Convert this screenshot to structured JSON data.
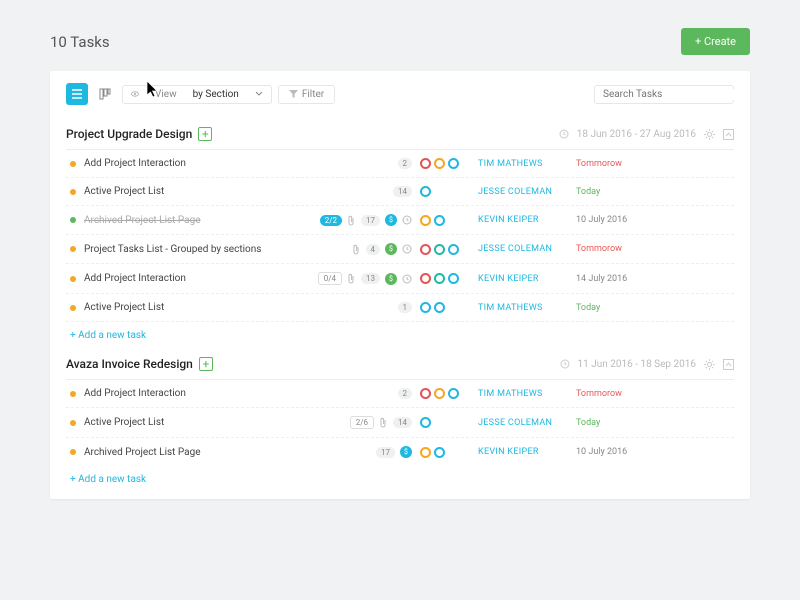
{
  "header": {
    "title": "10 Tasks",
    "create_label": "+ Create"
  },
  "toolbar": {
    "view_label": "View",
    "view_value": "by Section",
    "filter_label": "Filter",
    "search_placeholder": "Search Tasks"
  },
  "colors": {
    "orange": "#f5a623",
    "red": "#e55353",
    "teal": "#1fb9a8",
    "blue": "#1eb8e0",
    "green": "#5cb85c"
  },
  "sections": [
    {
      "title": "Project Upgrade Design",
      "date_range": "18 Jun 2016 - 27 Aug 2016",
      "tasks": [
        {
          "dot": "orange",
          "name": "Add Project Interaction",
          "badges": [
            {
              "t": "pill",
              "v": "2"
            }
          ],
          "rings": [
            "red",
            "orange",
            "blue"
          ],
          "assignee": "TIM MATHEWS",
          "due": "Tommorow",
          "due_style": "red"
        },
        {
          "dot": "orange",
          "name": "Active Project List",
          "badges": [
            {
              "t": "pill",
              "v": "14"
            }
          ],
          "rings": [
            "blue"
          ],
          "assignee": "JESSE COLEMAN",
          "due": "Today",
          "due_style": "green"
        },
        {
          "dot": "green",
          "name": "Archived Project List Page",
          "done": true,
          "badges": [
            {
              "t": "pill-blue",
              "v": "2/2"
            },
            {
              "t": "clip"
            },
            {
              "t": "pill",
              "v": "17"
            },
            {
              "t": "circ-blue",
              "v": "$"
            },
            {
              "t": "clock"
            }
          ],
          "rings": [
            "orange",
            "blue"
          ],
          "assignee": "KEVIN KEIPER",
          "due": "10 July 2016",
          "due_style": "gray"
        },
        {
          "dot": "orange",
          "name": "Project Tasks List - Grouped by sections",
          "badges": [
            {
              "t": "clip"
            },
            {
              "t": "pill",
              "v": "4"
            },
            {
              "t": "circ-green",
              "v": "$"
            },
            {
              "t": "clock"
            }
          ],
          "rings": [
            "red",
            "teal",
            "blue"
          ],
          "assignee": "JESSE COLEMAN",
          "due": "Tommorow",
          "due_style": "red"
        },
        {
          "dot": "orange",
          "name": "Add Project Interaction",
          "badges": [
            {
              "t": "pill-box",
              "v": "0/4"
            },
            {
              "t": "clip"
            },
            {
              "t": "pill",
              "v": "13"
            },
            {
              "t": "circ-green",
              "v": "$"
            },
            {
              "t": "clock"
            }
          ],
          "rings": [
            "red",
            "teal",
            "blue"
          ],
          "assignee": "KEVIN KEIPER",
          "due": "14 July 2016",
          "due_style": "gray"
        },
        {
          "dot": "orange",
          "name": "Active Project List",
          "badges": [
            {
              "t": "pill",
              "v": "1"
            }
          ],
          "rings": [
            "blue",
            "blue"
          ],
          "assignee": "TIM MATHEWS",
          "due": "Today",
          "due_style": "green"
        }
      ],
      "add_task_label": "+ Add a new task"
    },
    {
      "title": "Avaza Invoice Redesign",
      "date_range": "11 Jun 2016 - 18 Sep 2016",
      "tasks": [
        {
          "dot": "orange",
          "name": "Add Project Interaction",
          "badges": [
            {
              "t": "pill",
              "v": "2"
            }
          ],
          "rings": [
            "red",
            "orange",
            "blue"
          ],
          "assignee": "TIM MATHEWS",
          "due": "Tommorow",
          "due_style": "red"
        },
        {
          "dot": "orange",
          "name": "Active Project List",
          "badges": [
            {
              "t": "pill-box",
              "v": "2/6"
            },
            {
              "t": "clip"
            },
            {
              "t": "pill",
              "v": "14"
            }
          ],
          "rings": [
            "blue"
          ],
          "assignee": "JESSE COLEMAN",
          "due": "Today",
          "due_style": "green"
        },
        {
          "dot": "orange",
          "name": "Archived Project List Page",
          "badges": [
            {
              "t": "pill",
              "v": "17"
            },
            {
              "t": "circ-blue",
              "v": "$"
            }
          ],
          "rings": [
            "orange",
            "blue"
          ],
          "assignee": "KEVIN KEIPER",
          "due": "10 July 2016",
          "due_style": "gray"
        }
      ],
      "add_task_label": "+ Add a new task"
    }
  ]
}
